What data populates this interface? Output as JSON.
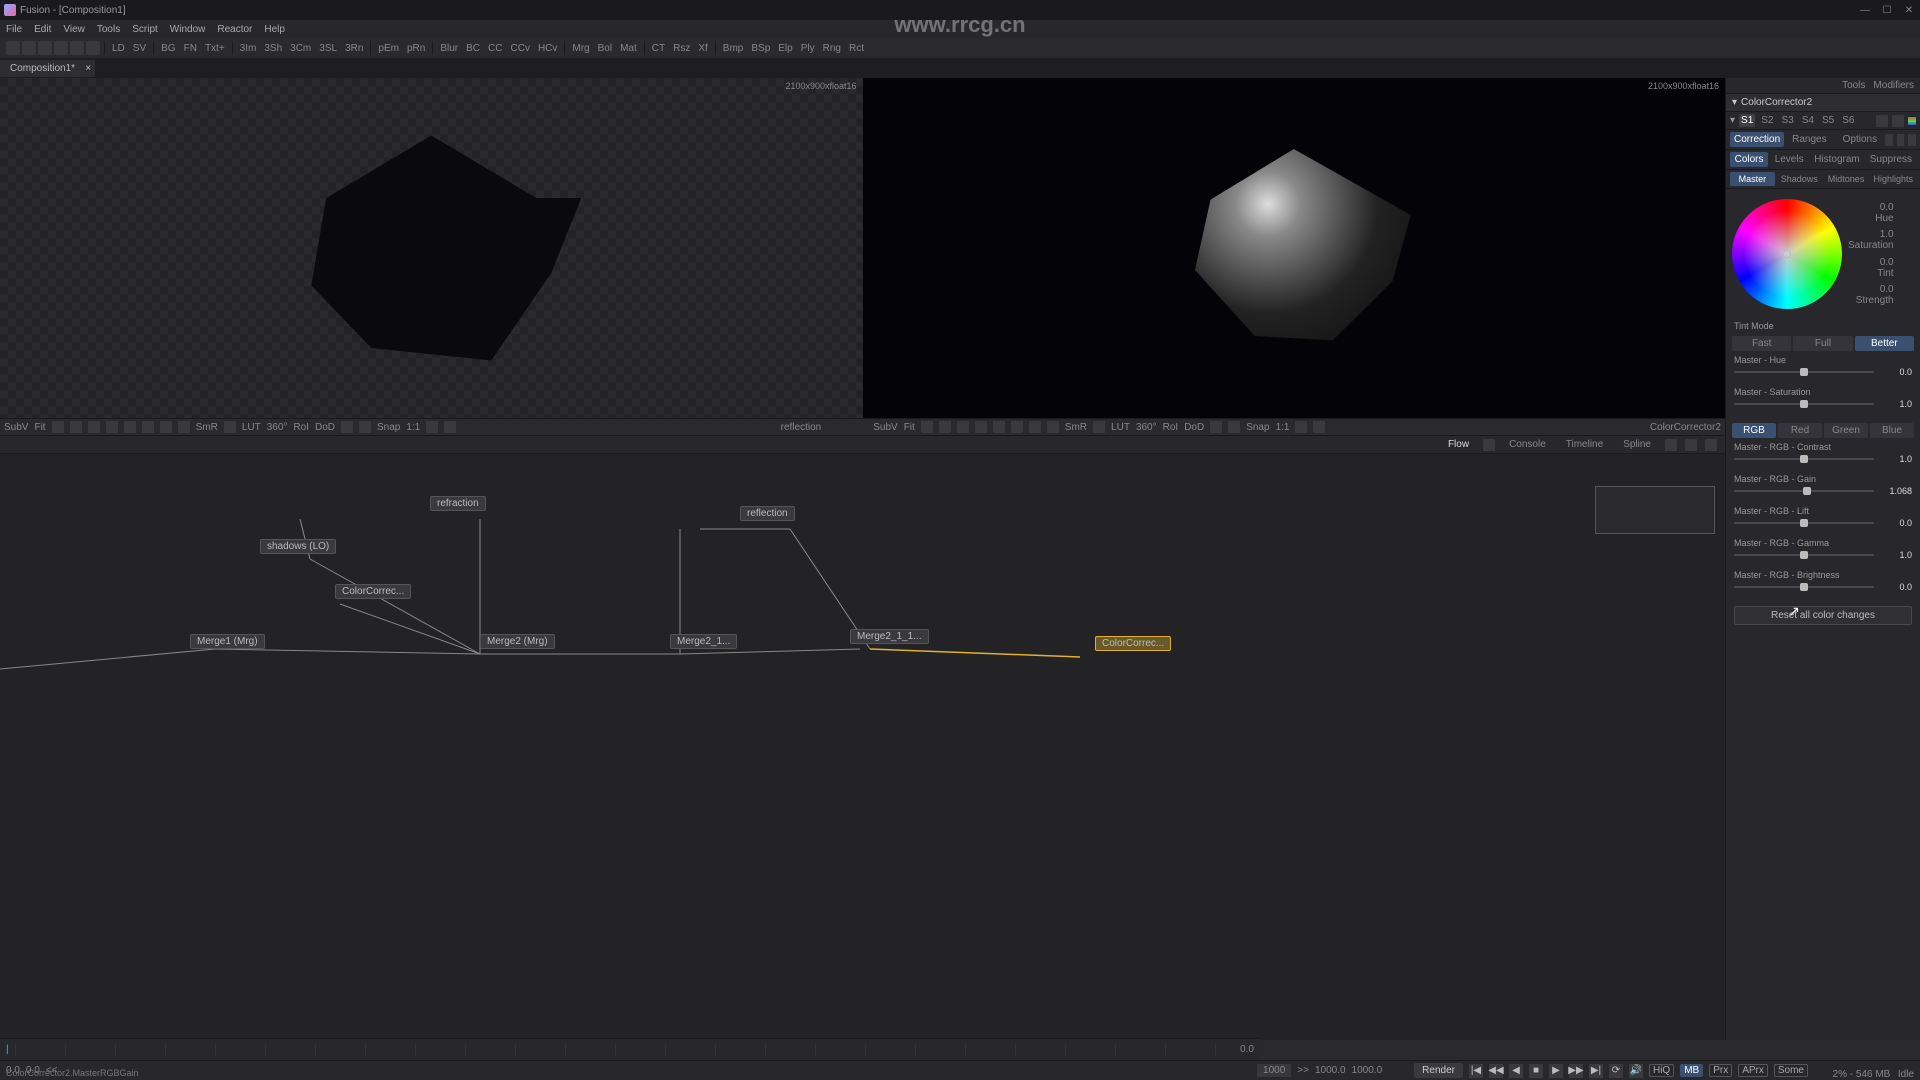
{
  "app": {
    "title": "Fusion - [Composition1]",
    "watermark": "www.rrcg.cn"
  },
  "menubar": [
    "File",
    "Edit",
    "View",
    "Tools",
    "Script",
    "Window",
    "Reactor",
    "Help"
  ],
  "toolbar": {
    "groups": [
      "LD",
      "SV",
      "BG",
      "FN",
      "Txt+",
      "3Im",
      "3Sh",
      "3Cm",
      "3SL",
      "3Rn",
      "pEm",
      "pRn",
      "Blur",
      "BC",
      "CC",
      "CCv",
      "HCv",
      "Mrg",
      "Bol",
      "Mat",
      "CT",
      "Rsz",
      "Xf",
      "Bmp",
      "BSp",
      "Elp",
      "Ply",
      "Rng",
      "Rct"
    ]
  },
  "tabs": [
    {
      "label": "Composition1*"
    }
  ],
  "viewer": {
    "info": "2100x900xfloat16",
    "left_name": "refraction",
    "right_name": "reflection"
  },
  "viewer_toolbar": {
    "items_left": [
      "SubV",
      "Fit",
      "LUT",
      "360°",
      "RoI",
      "DoD",
      "Snap",
      "SmR",
      "1:1"
    ],
    "label_center_left": "reflection",
    "label_center_right": "ColorCorrector2"
  },
  "flow": {
    "tabs": [
      "Flow",
      "Console",
      "Timeline",
      "Spline"
    ],
    "active_tab": "Flow",
    "nodes": {
      "refraction": "refraction",
      "reflection": "reflection",
      "shadows": "shadows (LO)",
      "colorcorrec1": "ColorCorrec...",
      "merge1": "Merge1 (Mrg)",
      "merge2": "Merge2 (Mrg)",
      "merge2_1": "Merge2_1...",
      "merge2_1_1": "Merge2_1_1...",
      "colorcorrec2": "ColorCorrec..."
    }
  },
  "inspector": {
    "header_tabs": [
      "Tools",
      "Modifiers"
    ],
    "title": "ColorCorrector2",
    "s_tabs": [
      "S1",
      "S2",
      "S3",
      "S4",
      "S5",
      "S6"
    ],
    "expr_tabs": [
      "Correction",
      "Ranges",
      "Options",
      "Settings"
    ],
    "mode_tabs": [
      "Colors",
      "Levels",
      "Histogram",
      "Suppress"
    ],
    "range_tabs": [
      "Master",
      "Shadows",
      "Midtones",
      "Highlights"
    ],
    "wheel": [
      {
        "label": "Hue",
        "value": "0.0"
      },
      {
        "label": "Saturation",
        "value": "1.0"
      },
      {
        "label": "Tint",
        "value": "0.0"
      },
      {
        "label": "Strength",
        "value": "0.0"
      }
    ],
    "tint_mode_label": "Tint Mode",
    "tint_modes": [
      "Fast",
      "Full",
      "Better"
    ],
    "params1": [
      {
        "label": "Master - Hue",
        "value": "0.0",
        "pos": 50
      },
      {
        "label": "Master - Saturation",
        "value": "1.0",
        "pos": 50
      }
    ],
    "rgb_tabs": [
      "RGB",
      "Red",
      "Green",
      "Blue"
    ],
    "params2": [
      {
        "label": "Master - RGB - Contrast",
        "value": "1.0",
        "pos": 50
      },
      {
        "label": "Master - RGB - Gain",
        "value": "1.068",
        "pos": 52
      },
      {
        "label": "Master - RGB - Lift",
        "value": "0.0",
        "pos": 50
      },
      {
        "label": "Master - RGB - Gamma",
        "value": "1.0",
        "pos": 50
      },
      {
        "label": "Master - RGB - Brightness",
        "value": "0.0",
        "pos": 50
      }
    ],
    "reset_button": "Reset all color changes"
  },
  "timeline": {
    "start": "0.0",
    "end": "1000.0",
    "current": "0.0",
    "global_start": "0.0",
    "global_end": "1000.0",
    "render_end": "1000"
  },
  "transport": {
    "render": "Render",
    "labels": [
      "HiQ",
      "MB",
      "Prx",
      "APrx",
      "Some"
    ],
    "left_values": [
      "0.0",
      "0.0",
      "<<"
    ]
  },
  "status": {
    "memory": "2% - 546 MB",
    "state": "Idle",
    "footer": "ColorCorrector2.MasterRGBGain"
  }
}
